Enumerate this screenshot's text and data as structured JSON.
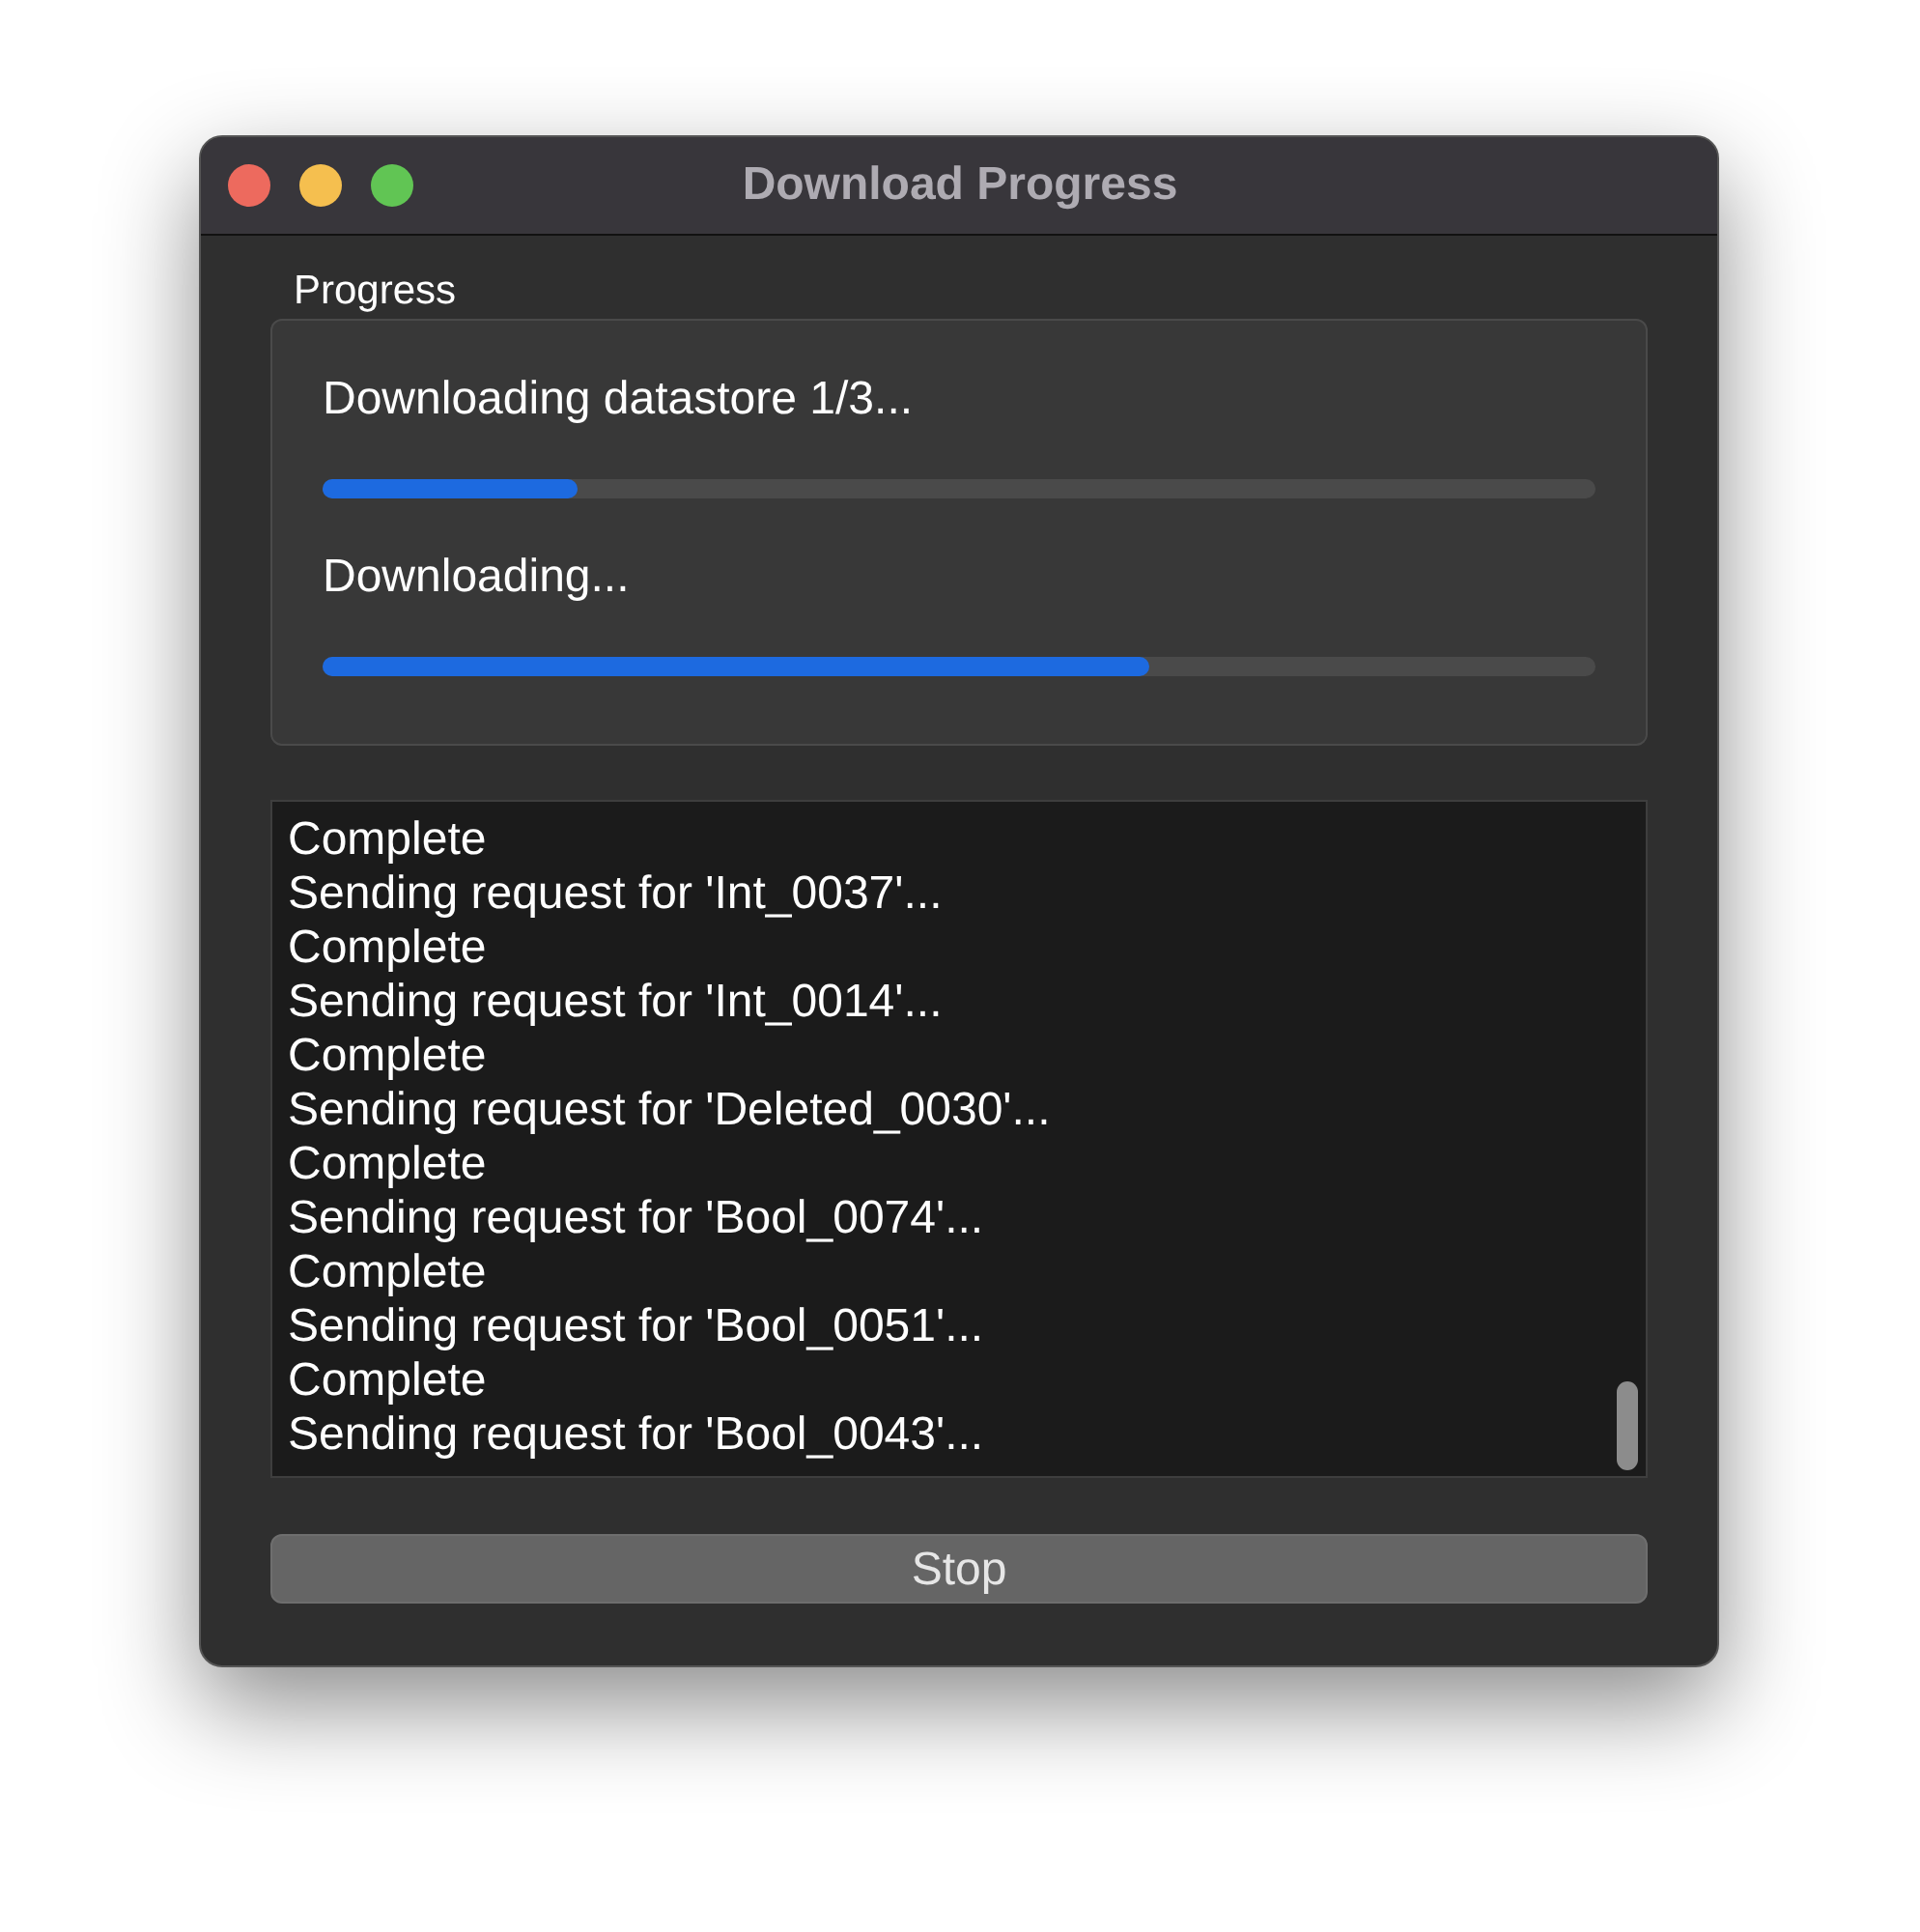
{
  "window": {
    "title": "Download Progress"
  },
  "progress_group": {
    "label": "Progress",
    "items": [
      {
        "label": "Downloading datastore 1/3...",
        "level": 0.2
      },
      {
        "label": "Downloading...",
        "level": 0.65
      }
    ]
  },
  "log": {
    "lines": [
      "Complete",
      "Sending request for 'Int_0037'...",
      "Complete",
      "Sending request for 'Int_0014'...",
      "Complete",
      "Sending request for 'Deleted_0030'...",
      "Complete",
      "Sending request for 'Bool_0074'...",
      "Complete",
      "Sending request for 'Bool_0051'...",
      "Complete",
      "Sending request for 'Bool_0043'..."
    ]
  },
  "buttons": [
    {
      "label": "Stop"
    }
  ]
}
